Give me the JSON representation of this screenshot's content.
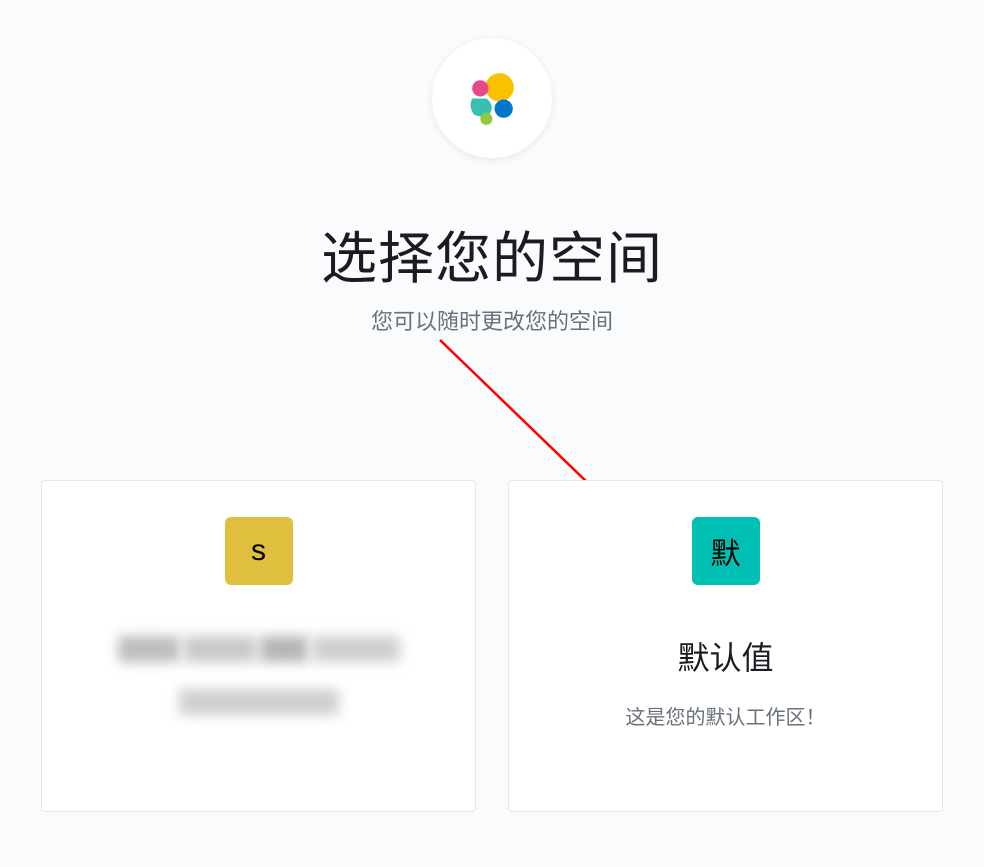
{
  "header": {
    "title": "选择您的空间",
    "subtitle": "您可以随时更改您的空间"
  },
  "spaces": [
    {
      "icon_letter": "s",
      "icon_color": "yellow",
      "title_redacted": true,
      "desc_redacted": true
    },
    {
      "icon_letter": "默",
      "icon_color": "teal",
      "title": "默认值",
      "description": "这是您的默认工作区！"
    }
  ]
}
